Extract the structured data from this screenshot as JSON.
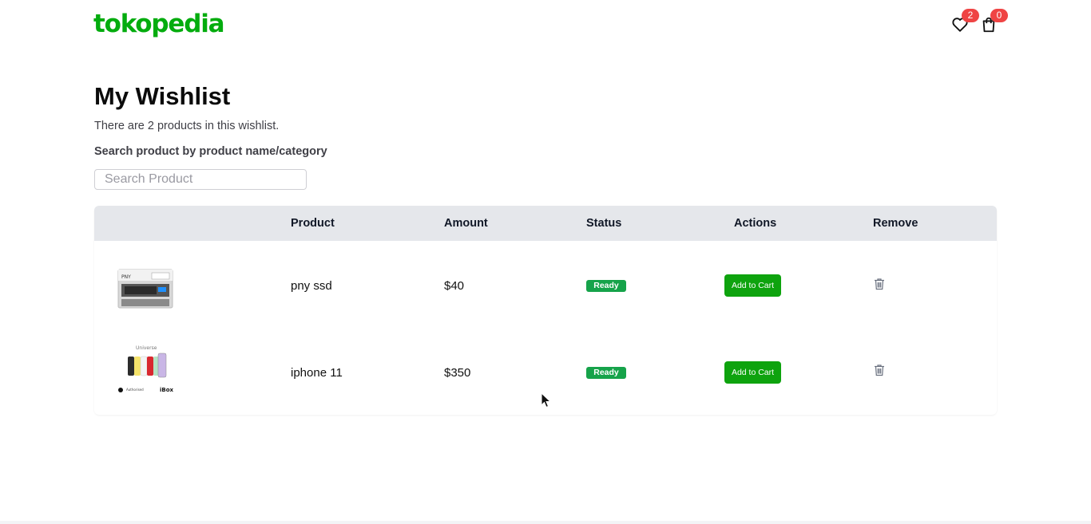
{
  "header": {
    "logo": "tokopedia",
    "wishlist_count": "2",
    "cart_count": "0"
  },
  "page": {
    "title": "My Wishlist",
    "subtitle": "There are 2 products in this wishlist.",
    "search_label": "Search product by product name/category",
    "search_placeholder": "Search Product",
    "search_value": ""
  },
  "table": {
    "columns": [
      "",
      "Product",
      "Amount",
      "Status",
      "Actions",
      "Remove"
    ],
    "rows": [
      {
        "image": "pny-ssd-photo",
        "product": "pny ssd",
        "amount": "$40",
        "status": "Ready",
        "action": "Add to Cart"
      },
      {
        "image": "iphone-11-photo",
        "product": "iphone 11",
        "amount": "$350",
        "status": "Ready",
        "action": "Add to Cart"
      }
    ]
  },
  "colors": {
    "brand": "#03ac0e",
    "badge": "#ef4444",
    "status": "#16a34a",
    "header_bg": "#e5e7eb"
  },
  "icons": {
    "wishlist": "heart-icon",
    "cart": "shopping-bag-icon",
    "remove": "trash-icon",
    "pointer": "mouse-cursor"
  }
}
